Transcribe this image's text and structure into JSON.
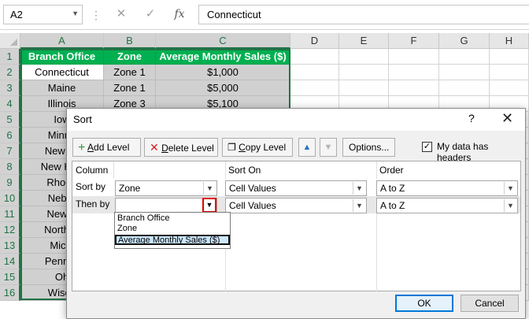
{
  "formula_bar": {
    "name_box": "A2",
    "cancel_glyph": "✕",
    "enter_glyph": "✓",
    "fx_glyph": "fx",
    "formula_value": "Connecticut"
  },
  "sheet": {
    "columns": [
      "A",
      "B",
      "C",
      "D",
      "E",
      "F",
      "G",
      "H"
    ],
    "rows": [
      "1",
      "2",
      "3",
      "4",
      "5",
      "6",
      "7",
      "8",
      "9",
      "10",
      "11",
      "12",
      "13",
      "14",
      "15",
      "16"
    ],
    "headers": [
      "Branch Office",
      "Zone",
      "Average Monthly Sales ($)"
    ],
    "data": [
      [
        "Connecticut",
        "Zone 1",
        "$1,000"
      ],
      [
        "Maine",
        "Zone 1",
        "$5,000"
      ],
      [
        "Illinois",
        "Zone 3",
        "$5,100"
      ],
      [
        "Iow",
        "",
        ""
      ],
      [
        "Minne",
        "",
        ""
      ],
      [
        "New Je",
        "",
        ""
      ],
      [
        "New Han",
        "",
        ""
      ],
      [
        "Rhode",
        "",
        ""
      ],
      [
        "Nebra",
        "",
        ""
      ],
      [
        "New Y",
        "",
        ""
      ],
      [
        "North D",
        "",
        ""
      ],
      [
        "Michi",
        "",
        ""
      ],
      [
        "Pennsy",
        "",
        ""
      ],
      [
        "Oh",
        "",
        ""
      ],
      [
        "Wisco",
        "",
        ""
      ]
    ],
    "colors": {
      "header_green": "#00b050",
      "selection_green": "#217346",
      "data_gray": "#d0d0d0"
    }
  },
  "dialog": {
    "title": "Sort",
    "help": "?",
    "close": "✕",
    "toolbar": {
      "add_level": "Add Level",
      "delete_level": "Delete Level",
      "copy_level": "Copy Level",
      "options": "Options..."
    },
    "my_data_has_headers": {
      "label": "My data has headers",
      "checked": true
    },
    "columns": {
      "column": "Column",
      "sort_on": "Sort On",
      "order": "Order"
    },
    "levels": [
      {
        "label": "Sort by",
        "column": "Zone",
        "sort_on": "Cell Values",
        "order": "A to Z"
      },
      {
        "label": "Then by",
        "column": "",
        "sort_on": "Cell Values",
        "order": "A to Z"
      }
    ],
    "dropdown_options": [
      "Branch Office",
      "Zone",
      "Average Monthly Sales ($)"
    ],
    "dropdown_highlighted": "Average Monthly Sales ($)",
    "ok": "OK",
    "cancel": "Cancel"
  }
}
